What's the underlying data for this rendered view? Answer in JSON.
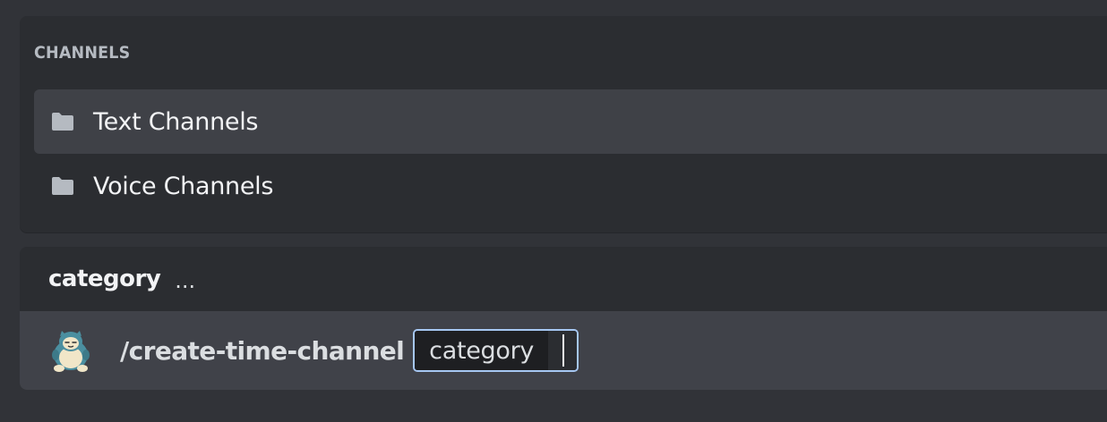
{
  "channels": {
    "header": "CHANNELS",
    "items": [
      {
        "label": "Text Channels",
        "icon": "folder-icon",
        "selected": true
      },
      {
        "label": "Voice Channels",
        "icon": "folder-icon",
        "selected": false
      }
    ]
  },
  "autocomplete": {
    "title": "category",
    "ellipsis": "...",
    "command": {
      "avatar_icon": "snorlax-avatar-icon",
      "name": "/create-time-channel",
      "option_name": "category",
      "option_value": ""
    }
  },
  "colors": {
    "background": "#313338",
    "panel": "#2b2d31",
    "selected_row": "#3f4147",
    "command_row": "#404249",
    "focus_border": "#a6c7f2"
  }
}
